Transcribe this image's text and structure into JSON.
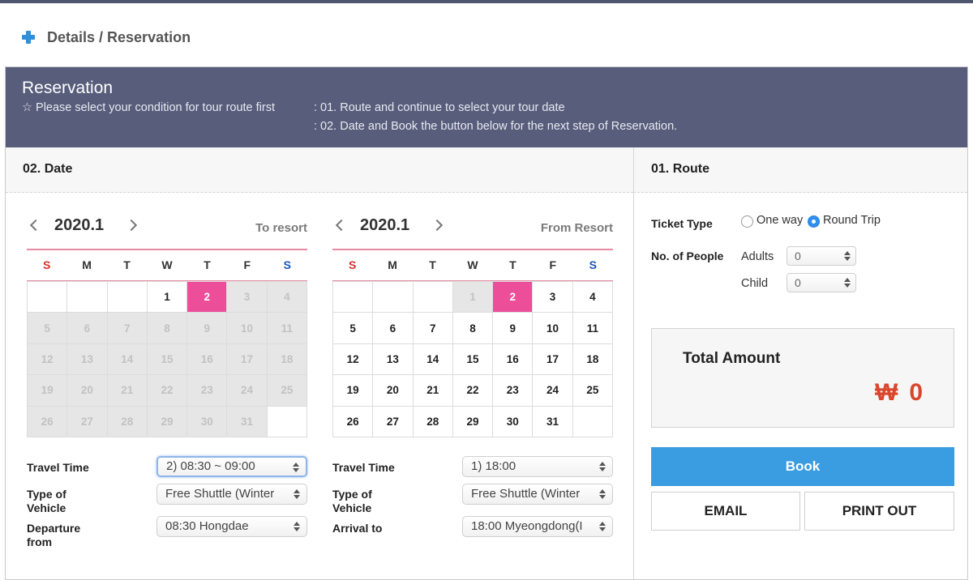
{
  "header": {
    "title": "Details / Reservation"
  },
  "banner": {
    "title": "Reservation",
    "note": "☆ Please select your condition for tour route first",
    "step1": ": 01. Route and continue to select your tour date",
    "step2": ": 02. Date and Book the button below for the next step of Reservation."
  },
  "date_section": {
    "title": "02. Date"
  },
  "route_section": {
    "title": "01. Route"
  },
  "weekdays": [
    "S",
    "M",
    "T",
    "W",
    "T",
    "F",
    "S"
  ],
  "calendars": [
    {
      "month": "2020.1",
      "direction": "To resort",
      "cells": [
        "",
        "",
        "",
        "1",
        "2",
        "3",
        "4",
        "5",
        "6",
        "7",
        "8",
        "9",
        "10",
        "11",
        "12",
        "13",
        "14",
        "15",
        "16",
        "17",
        "18",
        "19",
        "20",
        "21",
        "22",
        "23",
        "24",
        "25",
        "26",
        "27",
        "28",
        "29",
        "30",
        "31",
        ""
      ],
      "disabled_days": [
        "3",
        "4",
        "5",
        "6",
        "7",
        "8",
        "9",
        "10",
        "11",
        "12",
        "13",
        "14",
        "15",
        "16",
        "17",
        "18",
        "19",
        "20",
        "21",
        "22",
        "23",
        "24",
        "25",
        "26",
        "27",
        "28",
        "29",
        "30",
        "31"
      ],
      "selected_day": "2"
    },
    {
      "month": "2020.1",
      "direction": "From Resort",
      "cells": [
        "",
        "",
        "",
        "1",
        "2",
        "3",
        "4",
        "5",
        "6",
        "7",
        "8",
        "9",
        "10",
        "11",
        "12",
        "13",
        "14",
        "15",
        "16",
        "17",
        "18",
        "19",
        "20",
        "21",
        "22",
        "23",
        "24",
        "25",
        "26",
        "27",
        "28",
        "29",
        "30",
        "31",
        ""
      ],
      "disabled_days": [
        "1"
      ],
      "selected_day": "2"
    }
  ],
  "to_form": {
    "travel_time_label": "Travel Time",
    "travel_time_value": "2) 08:30 ~ 09:00",
    "vehicle_label_1": "Type of",
    "vehicle_label_2": "Vehicle",
    "vehicle_value": "Free Shuttle (Winter",
    "departure_label_1": "Departure",
    "departure_label_2": "from",
    "departure_value": "08:30 Hongdae"
  },
  "from_form": {
    "travel_time_label": "Travel Time",
    "travel_time_value": "1) 18:00",
    "vehicle_label_1": "Type of",
    "vehicle_label_2": "Vehicle",
    "vehicle_value": "Free Shuttle (Winter",
    "arrival_label": "Arrival to",
    "arrival_value": "18:00 Myeongdong(I"
  },
  "route": {
    "ticket_type_label": "Ticket Type",
    "one_way": "One way",
    "round_trip": "Round Trip",
    "selected_ticket": "round_trip",
    "people_label": "No. of People",
    "adults_label": "Adults",
    "adults_value": "0",
    "child_label": "Child",
    "child_value": "0"
  },
  "total": {
    "label": "Total Amount",
    "currency": "₩",
    "value": "0"
  },
  "buttons": {
    "book": "Book",
    "email": "EMAIL",
    "print": "PRINT OUT"
  },
  "colors": {
    "banner": "#575d7b",
    "selected_day": "#ec4e9a",
    "book_button": "#3a9de2",
    "amount": "#d9462c",
    "sunday": "#d8322b",
    "saturday": "#1a55b8"
  }
}
